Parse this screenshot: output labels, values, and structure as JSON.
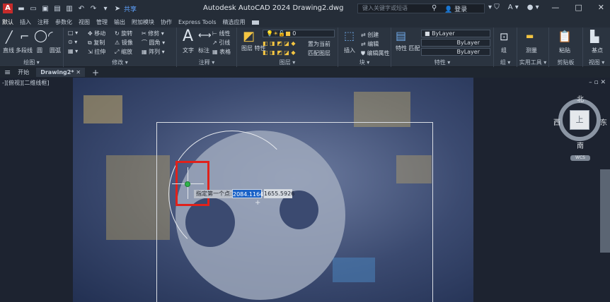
{
  "titlebar": {
    "logo": "A",
    "share_label": "共享",
    "title": "Autodesk AutoCAD 2024  Drawing2.dwg",
    "search_placeholder": "键入关键字或短语",
    "user_label": "登录",
    "minimize": "—",
    "maximize": "□",
    "close": "✕"
  },
  "ribbon_tabs": [
    "默认",
    "插入",
    "注释",
    "参数化",
    "视图",
    "管理",
    "输出",
    "附加模块",
    "协作",
    "Express Tools",
    "精选应用"
  ],
  "ribbon": {
    "draw": {
      "title": "绘图 ▾",
      "line": "直线",
      "polyline": "多段线",
      "circle": "圆",
      "arc": "圆弧"
    },
    "modify": {
      "title": "修改 ▾",
      "move": "移动",
      "rotate": "旋转",
      "trim": "修剪",
      "copy": "复制",
      "mirror": "镜像",
      "fillet": "圆角",
      "stretch": "拉伸",
      "scale": "缩放",
      "array": "阵列"
    },
    "annotation": {
      "title": "注释 ▾",
      "text": "文字",
      "dimension": "标注",
      "linear": "线性",
      "leader": "引线",
      "table": "表格"
    },
    "layers": {
      "title": "图层 ▾",
      "layer_props": "图层\n特性",
      "current_layer": "0",
      "make_current": "置为当前",
      "match_layer": "匹配图层"
    },
    "block": {
      "title": "块 ▾",
      "insert": "插入",
      "create": "创建",
      "edit": "编辑",
      "edit_attr": "编辑属性"
    },
    "properties": {
      "title": "特性 ▾",
      "match": "特性\n匹配",
      "color": "ByLayer",
      "linetype": "ByLayer",
      "lineweight": "ByLayer"
    },
    "groups": {
      "title": "组 ▾",
      "group": "组"
    },
    "utilities": {
      "title": "实用工具 ▾",
      "measure": "测量"
    },
    "clipboard": {
      "title": "剪贴板",
      "paste": "粘贴"
    },
    "view": {
      "title": "视图 ▾",
      "base": "基点"
    }
  },
  "filetabs": {
    "start": "开始",
    "current": "Drawing2*",
    "close": "✕",
    "add": "+"
  },
  "viewport": {
    "label": "-][俯视][二维线框]",
    "controls": "– ▫ ✕",
    "tooltip": "指定第一个点:",
    "coord_x": "2084.1164",
    "coord_y": "1655.5926"
  },
  "viewcube": {
    "north": "北",
    "south": "南",
    "east": "东",
    "west": "西",
    "top": "上",
    "wcs": "WCS"
  }
}
